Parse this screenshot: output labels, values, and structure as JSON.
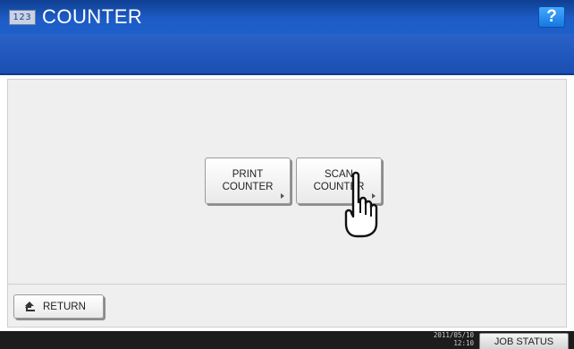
{
  "header": {
    "icon_text": "123",
    "title": "COUNTER",
    "help_label": "?"
  },
  "main": {
    "buttons": [
      {
        "line1": "PRINT",
        "line2": "COUNTER"
      },
      {
        "line1": "SCAN",
        "line2": "COUNTER"
      }
    ]
  },
  "footer": {
    "return_label": "RETURN",
    "date": "2011/05/10",
    "time": "12:10",
    "job_status_label": "JOB STATUS"
  },
  "icons": {
    "app": "counter-app-icon",
    "help": "help-icon",
    "return": "return-arrow-icon",
    "cursor": "hand-pointer-icon",
    "submenu": "submenu-arrow-icon"
  },
  "colors": {
    "title_bar": "#1d5cc6",
    "sub_bar": "#1a4fb3",
    "help_button": "#1478e0",
    "panel": "#efefef",
    "status_bar": "#1c1c1c"
  }
}
